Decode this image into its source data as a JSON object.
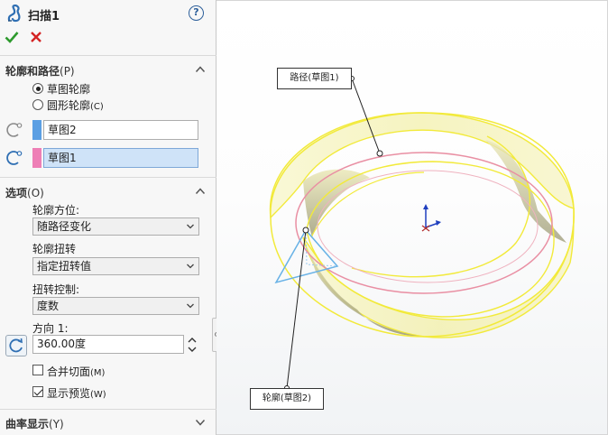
{
  "header": {
    "title": "扫描1",
    "help_glyph": "?"
  },
  "sections": {
    "profile_path": {
      "title": "轮廓和路径",
      "hotkey": "(P)",
      "radio_sketch": "草图轮廓",
      "radio_circle": "圆形轮廓",
      "radio_circle_hotkey": "(C)",
      "profile_selection": "草图2",
      "path_selection": "草图1"
    },
    "options": {
      "title": "选项",
      "hotkey": "(O)",
      "orientation_label": "轮廓方位:",
      "orientation_value": "随路径变化",
      "twist_label": "轮廓扭转",
      "twist_value": "指定扭转值",
      "twist_control_label": "扭转控制:",
      "twist_control_value": "度数",
      "direction_label": "方向 1:",
      "direction_value": "360.00度",
      "merge_faces_label": "合并切面",
      "merge_faces_hotkey": "(M)",
      "merge_faces_checked": false,
      "show_preview_label": "显示预览",
      "show_preview_hotkey": "(W)",
      "show_preview_checked": true
    },
    "curvature": {
      "title": "曲率显示",
      "hotkey": "(Y)"
    }
  },
  "viewport": {
    "callout_path": "路径(草图1)",
    "callout_profile": "轮廓(草图2)"
  },
  "colors": {
    "profile_swatch": "#5b9fe3",
    "path_swatch": "#ee7fb6",
    "sweep_edge": "#f2ea3a",
    "sweep_fill": "#f6f3b8",
    "path_curve": "#e98fa3",
    "profile_triangle": "#68b2e6",
    "accept": "#2e9a2e",
    "cancel": "#d42424"
  },
  "icons": {
    "feature": "sweep-icon",
    "help": "help-icon",
    "ok": "checkmark-icon",
    "cancel": "cross-icon",
    "profile_selector": "profile-selector-icon",
    "path_selector": "path-selector-icon",
    "direction": "reverse-direction-icon",
    "triad": "triad-icon"
  }
}
